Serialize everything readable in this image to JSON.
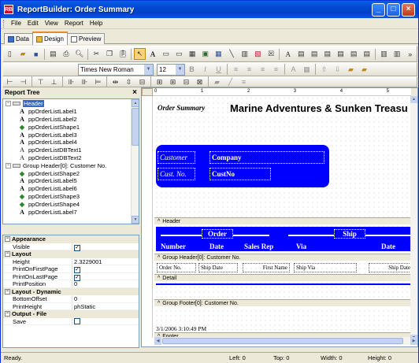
{
  "window": {
    "title": "ReportBuilder: Order Summary",
    "app_icon": "RB"
  },
  "menu": [
    "File",
    "Edit",
    "View",
    "Report",
    "Help"
  ],
  "tabs": [
    {
      "label": "Data",
      "icon": "data-icon"
    },
    {
      "label": "Design",
      "icon": "design-icon",
      "active": true
    },
    {
      "label": "Preview",
      "icon": "preview-icon"
    }
  ],
  "toolbar": {
    "font_name": "Times New Roman",
    "font_size": "12"
  },
  "report_tree": {
    "title": "Report Tree",
    "items": [
      {
        "label": "Header",
        "kind": "band",
        "selected": true
      },
      {
        "label": "ppOrderListLabel1",
        "kind": "label"
      },
      {
        "label": "ppOrderListLabel2",
        "kind": "label"
      },
      {
        "label": "ppOrderListShape1",
        "kind": "shape"
      },
      {
        "label": "ppOrderListLabel3",
        "kind": "label"
      },
      {
        "label": "ppOrderListLabel4",
        "kind": "label"
      },
      {
        "label": "ppOrderListDBText1",
        "kind": "dbtext"
      },
      {
        "label": "ppOrderListDBText2",
        "kind": "dbtext"
      },
      {
        "label": "Group Header[0]: Customer No.",
        "kind": "band"
      },
      {
        "label": "ppOrderListShape2",
        "kind": "shape"
      },
      {
        "label": "ppOrderListLabel5",
        "kind": "label"
      },
      {
        "label": "ppOrderListLabel6",
        "kind": "label"
      },
      {
        "label": "ppOrderListShape3",
        "kind": "shape"
      },
      {
        "label": "ppOrderListShape4",
        "kind": "shape"
      },
      {
        "label": "ppOrderListLabel7",
        "kind": "label"
      }
    ]
  },
  "properties": [
    {
      "category": "Appearance",
      "rows": [
        {
          "name": "Visible",
          "checkbox": true
        }
      ]
    },
    {
      "category": "Layout",
      "rows": [
        {
          "name": "Height",
          "value": "2.3229001"
        },
        {
          "name": "PrintOnFirstPage",
          "checkbox": true
        },
        {
          "name": "PrintOnLastPage",
          "checkbox": true
        },
        {
          "name": "PrintPosition",
          "value": "0"
        }
      ]
    },
    {
      "category": "Layout - Dynamic",
      "rows": [
        {
          "name": "BottomOffset",
          "value": "0"
        },
        {
          "name": "PrintHeight",
          "value": "phStatic"
        }
      ]
    },
    {
      "category": "Output - File",
      "rows": [
        {
          "name": "Save",
          "checkbox": false
        }
      ]
    }
  ],
  "report": {
    "title_left": "Order Summary",
    "title_main": "Marine Adventures & Sunken Treasu",
    "customer_label": "Customer",
    "customer_value": "Company",
    "custno_label": "Cust. No.",
    "custno_value": "CustNo",
    "band_header": "Header",
    "group_order": "Order",
    "group_ship": "Ship",
    "col_number": "Number",
    "col_date": "Date",
    "col_salesrep": "Sales Rep",
    "col_via": "Via",
    "col_date2": "Date",
    "band_group_header": "Group Header[0]: Customer No.",
    "field_orderno": "Order No.",
    "field_shipdate": "Ship Date",
    "field_firstname": "First Name",
    "field_shipvia": "Ship Via",
    "field_shipdate2": "Ship Date",
    "band_detail": "Detail",
    "band_group_footer": "Group Footer[0]: Customer No.",
    "footer_timestamp": "3/1/2006 3:10:49 PM",
    "band_footer": "Footer",
    "ruler_marks": [
      "0",
      "1",
      "2",
      "3",
      "4",
      "5"
    ]
  },
  "status": {
    "text": "Ready.",
    "left": "Left: 0",
    "top": "Top: 0",
    "width": "Width: 0",
    "height": "Height: 0"
  },
  "colors": {
    "accent": "#0000ff",
    "titlebar": "#0047d0"
  }
}
